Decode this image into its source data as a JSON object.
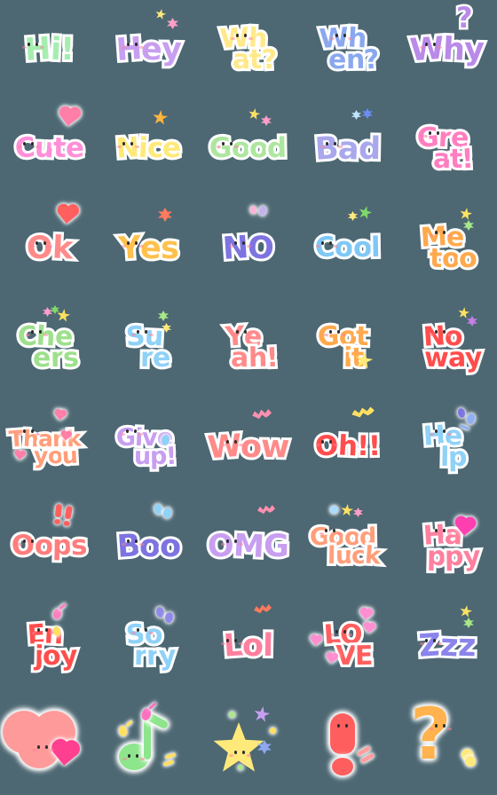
{
  "app": {
    "title": "Emoji Sticker Pack Preview",
    "background_color": "#4d6873",
    "grid": {
      "columns": 5,
      "rows": 8,
      "cell_size": 112
    }
  },
  "palette": {
    "mint": "#a6edb0",
    "lavender": "#c79ef0",
    "butter": "#ffe98a",
    "cornflower": "#8aa8f0",
    "orchid": "#b98ae8",
    "pink": "#ff8fd8",
    "lemon": "#ffe978",
    "sage": "#aee6a0",
    "periwinkle": "#a9a8ec",
    "hotpink": "#ff7ec0",
    "salmon": "#ff8a8a",
    "amber": "#ffc04d",
    "violet": "#7d74e0",
    "sky": "#7fc8f5",
    "tangerine": "#ffa94d",
    "grass": "#9ee08c",
    "babyblue": "#8fd1f7",
    "coral": "#ff7d7d",
    "crimson": "#ff4d4d",
    "rose": "#ff7f9e",
    "orange": "#ffa04d",
    "peach": "#ff9e7a",
    "white": "#ffffff"
  },
  "stickers": [
    {
      "id": "hi",
      "label": "Hi!",
      "lines": [
        "Hi!"
      ],
      "color": "#a6edb0",
      "face_on": 0,
      "decor": "none"
    },
    {
      "id": "hey",
      "label": "Hey",
      "lines": [
        "Hey"
      ],
      "color": "#c79ef0",
      "face_on": 0,
      "decor": "star-pink"
    },
    {
      "id": "what",
      "label": "What?",
      "lines": [
        "Wh",
        "at?"
      ],
      "color": "#ffe98a",
      "face_on": 1,
      "decor": "none",
      "accent": "#ffb04d"
    },
    {
      "id": "when",
      "label": "When?",
      "lines": [
        "Wh",
        "en?"
      ],
      "color": "#8aa8f0",
      "face_on": 1,
      "decor": "none",
      "accent": "#4f6fd9"
    },
    {
      "id": "why",
      "label": "Why?",
      "lines": [
        "Why"
      ],
      "color": "#b98ae8",
      "face_on": 1,
      "decor": "qmark"
    },
    {
      "id": "cute",
      "label": "Cute",
      "lines": [
        "Cute"
      ],
      "color": "#ff8fd8",
      "face_on": 0,
      "decor": "heart-pink"
    },
    {
      "id": "nice",
      "label": "Nice",
      "lines": [
        "Nice"
      ],
      "color": "#ffe978",
      "face_on": 0,
      "decor": "star-amber"
    },
    {
      "id": "good",
      "label": "Good",
      "lines": [
        "Good"
      ],
      "color": "#aee6a0",
      "face_on": 1,
      "decor": "star-duo"
    },
    {
      "id": "bad",
      "label": "Bad",
      "lines": [
        "Bad"
      ],
      "color": "#a9a8ec",
      "face_on": 1,
      "decor": "spark-blue"
    },
    {
      "id": "great",
      "label": "Great!",
      "lines": [
        "Gre",
        "at!"
      ],
      "color": "#ff7ec0",
      "face_on": 0,
      "decor": "none"
    },
    {
      "id": "ok",
      "label": "Ok",
      "lines": [
        "Ok"
      ],
      "color": "#ff8a8a",
      "face_on": 0,
      "decor": "heart-red"
    },
    {
      "id": "yes",
      "label": "Yes",
      "lines": [
        "Yes"
      ],
      "color": "#ffc04d",
      "face_on": 0,
      "decor": "star-coral"
    },
    {
      "id": "no",
      "label": "NO",
      "lines": [
        "NO"
      ],
      "color": "#7d74e0",
      "face_on": 0,
      "decor": "drops-pastel"
    },
    {
      "id": "cool",
      "label": "Cool",
      "lines": [
        "Cool"
      ],
      "color": "#7fc8f5",
      "face_on": 0,
      "decor": "star-green"
    },
    {
      "id": "me-too",
      "label": "Me too",
      "lines": [
        "Me",
        "too"
      ],
      "color": "#ffa94d",
      "face_on": 0,
      "decor": "star-yellow-green"
    },
    {
      "id": "cheers",
      "label": "Cheers",
      "lines": [
        "Che",
        "ers"
      ],
      "color": "#9ee08c",
      "face_on": 0,
      "decor": "star-trio"
    },
    {
      "id": "sure",
      "label": "Sure",
      "lines": [
        "Su",
        "re"
      ],
      "color": "#8fd1f7",
      "face_on": 0,
      "decor": "star-green-yellow"
    },
    {
      "id": "yeah",
      "label": "Yeah!",
      "lines": [
        "Ye",
        "ah!"
      ],
      "color": "#ff8a8a",
      "face_on": 0,
      "decor": "none"
    },
    {
      "id": "got-it",
      "label": "Got it",
      "lines": [
        "Got",
        "it"
      ],
      "color": "#ffa94d",
      "face_on": 0,
      "decor": "star-yellow-lower"
    },
    {
      "id": "no-way",
      "label": "No way",
      "lines": [
        "No",
        "way"
      ],
      "color": "#ff4d4d",
      "face_on": 0,
      "decor": "star-purple-yellow"
    },
    {
      "id": "thank-you",
      "label": "Thank you",
      "lines": [
        "Thank",
        "you"
      ],
      "color": "#ff9e7a",
      "face_on": 0,
      "decor": "hearts-small"
    },
    {
      "id": "give-up",
      "label": "Give up!",
      "lines": [
        "Give",
        "up!"
      ],
      "color": "#c79ef0",
      "face_on": 0,
      "decor": "drop-blue"
    },
    {
      "id": "wow",
      "label": "Wow",
      "lines": [
        "Wow"
      ],
      "color": "#ff8a8a",
      "face_on": 0,
      "decor": "squiggle-pink"
    },
    {
      "id": "oh",
      "label": "Oh!!",
      "lines": [
        "Oh!!"
      ],
      "color": "#ff4d4d",
      "face_on": 0,
      "decor": "squiggle-yellow"
    },
    {
      "id": "help",
      "label": "Help",
      "lines": [
        "He",
        "lp"
      ],
      "color": "#8fd1f7",
      "face_on": 0,
      "decor": "spark-violet"
    },
    {
      "id": "oops",
      "label": "Oops",
      "lines": [
        "Oops"
      ],
      "color": "#ff7d7d",
      "face_on": 0,
      "decor": "bang-red"
    },
    {
      "id": "boo",
      "label": "Boo",
      "lines": [
        "Boo"
      ],
      "color": "#7d74e0",
      "face_on": 0,
      "decor": "drops-blue"
    },
    {
      "id": "omg",
      "label": "OMG",
      "lines": [
        "OMG"
      ],
      "color": "#c79ef0",
      "face_on": 0,
      "decor": "squiggle-pink-top"
    },
    {
      "id": "good-luck",
      "label": "Good luck",
      "lines": [
        "Good",
        "luck"
      ],
      "color": "#ff9e7a",
      "face_on": 0,
      "decor": "dots-trio"
    },
    {
      "id": "happy",
      "label": "Happy",
      "lines": [
        "Ha",
        "ppy"
      ],
      "color": "#ff7f9e",
      "face_on": 0,
      "decor": "heart-magenta"
    },
    {
      "id": "enjoy",
      "label": "Enjoy",
      "lines": [
        "En",
        "joy"
      ],
      "color": "#ff4d4d",
      "face_on": 0,
      "decor": "notes-pink-yellow"
    },
    {
      "id": "sorry",
      "label": "Sorry",
      "lines": [
        "So",
        "rry"
      ],
      "color": "#8fd1f7",
      "face_on": 0,
      "decor": "drops-violet"
    },
    {
      "id": "lol",
      "label": "Lol",
      "lines": [
        "Lol"
      ],
      "color": "#ff7f9e",
      "face_on": 0,
      "decor": "squiggle-coral"
    },
    {
      "id": "love",
      "label": "LOVE",
      "lines": [
        "LO",
        "VE"
      ],
      "color": "#ff5e5e",
      "face_on": 1,
      "decor": "hearts-pink-scatter"
    },
    {
      "id": "zzz",
      "label": "Zzz",
      "lines": [
        "Zzz"
      ],
      "color": "#8a84ec",
      "face_on": 0,
      "decor": "star-yellow-green"
    },
    {
      "id": "heart-emoji",
      "label": "",
      "lines": [],
      "color": "#ff9a9a",
      "shape": "heart",
      "decor": "heart-small-magenta"
    },
    {
      "id": "music-note-emoji",
      "label": "",
      "lines": [],
      "color": "#8de58c",
      "shape": "note",
      "decor": "notes-mini"
    },
    {
      "id": "star-emoji",
      "label": "",
      "lines": [],
      "color": "#ffe97a",
      "shape": "star",
      "decor": "stars-scatter"
    },
    {
      "id": "exclamation-emoji",
      "label": "",
      "lines": [],
      "color": "#ff5e5e",
      "shape": "exclamation",
      "decor": "bang-lines"
    },
    {
      "id": "question-emoji",
      "label": "",
      "lines": [],
      "color": "#ffb24d",
      "shape": "question",
      "decor": "dot-yellow"
    }
  ]
}
